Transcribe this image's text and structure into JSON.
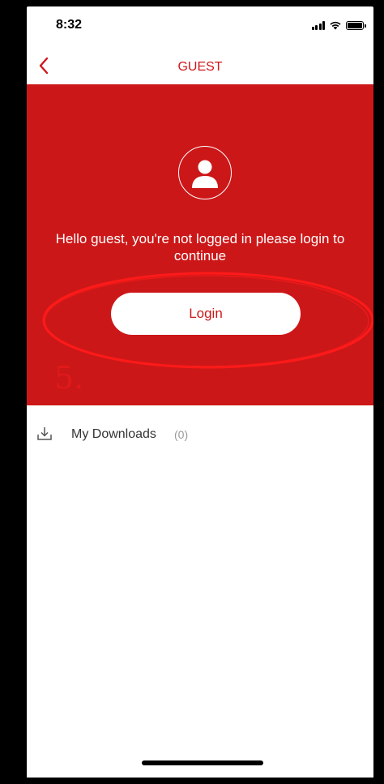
{
  "status_bar": {
    "time": "8:32",
    "icons": [
      "signal-icon",
      "wifi-icon",
      "battery-icon"
    ]
  },
  "nav": {
    "title": "GUEST",
    "back_icon": "chevron-left-icon"
  },
  "hero": {
    "background_color": "#cc1718",
    "avatar_icon": "user-avatar-icon",
    "greeting": "Hello guest, you're not logged in please login to continue",
    "login_label": "Login"
  },
  "annotation": {
    "number": "5."
  },
  "downloads": {
    "icon": "download-icon",
    "label": "My Downloads",
    "count": "(0)"
  },
  "colors": {
    "accent": "#d0181c",
    "white": "#ffffff"
  }
}
